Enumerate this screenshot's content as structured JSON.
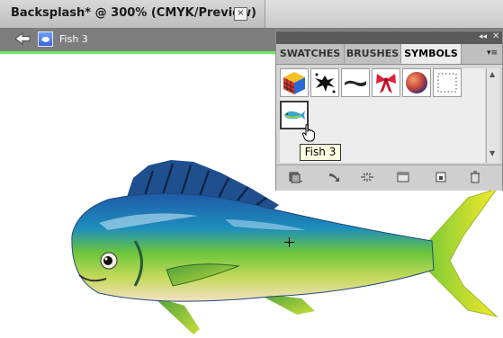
{
  "document_tab": {
    "title": "Backsplash* @ 300% (CMYK/Preview)",
    "close_glyph": "×"
  },
  "isolation_bar": {
    "breadcrumb_label": "Fish 3",
    "line_color": "#6fea5e"
  },
  "symbols_panel": {
    "tabs": [
      {
        "label": "SWATCHES",
        "active": false
      },
      {
        "label": "BRUSHES",
        "active": false
      },
      {
        "label": "SYMBOLS",
        "active": true
      }
    ],
    "header_icons": [
      "collapse-icon",
      "close-icon",
      "panel-menu-icon"
    ],
    "symbols": [
      {
        "name": "cube-symbol"
      },
      {
        "name": "splatter-symbol"
      },
      {
        "name": "brush-stroke-symbol"
      },
      {
        "name": "ribbon-bow-symbol"
      },
      {
        "name": "sphere-symbol"
      },
      {
        "name": "dotted-frame-symbol"
      },
      {
        "name": "fish-3-symbol",
        "selected": true
      }
    ],
    "tooltip": "Fish 3",
    "footer_icons": [
      "symbol-libraries-icon",
      "place-symbol-icon",
      "break-link-icon",
      "symbol-options-icon",
      "new-symbol-icon",
      "delete-symbol-icon"
    ]
  },
  "colors": {
    "panel_bg": "#d6d6d6",
    "isolation_bar_bg": "#7d7d7d",
    "tooltip_bg": "#ffffe1"
  }
}
